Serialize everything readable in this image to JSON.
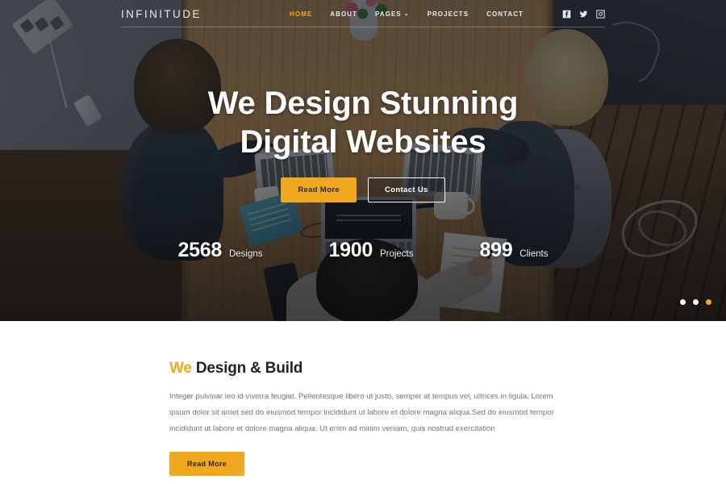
{
  "header": {
    "logo": "INFINITUDE",
    "nav": [
      {
        "label": "HOME",
        "active": true,
        "caret": ""
      },
      {
        "label": "ABOUT",
        "active": false,
        "caret": ""
      },
      {
        "label": "PAGES",
        "active": false,
        "caret": "⌄"
      },
      {
        "label": "PROJECTS",
        "active": false,
        "caret": ""
      },
      {
        "label": "CONTACT",
        "active": false,
        "caret": ""
      }
    ],
    "socials": [
      {
        "name": "facebook-icon"
      },
      {
        "name": "twitter-icon"
      },
      {
        "name": "instagram-icon"
      }
    ]
  },
  "hero": {
    "title_line1": "We Design Stunning",
    "title_line2": "Digital Websites",
    "primary_button": "Read More",
    "secondary_button": "Contact Us",
    "stats": [
      {
        "value": "2568",
        "label": "Designs"
      },
      {
        "value": "1900",
        "label": "Projects"
      },
      {
        "value": "899",
        "label": "Clients"
      }
    ],
    "slider_dots": [
      {
        "active": false
      },
      {
        "active": false
      },
      {
        "active": true
      }
    ]
  },
  "about": {
    "title_highlight": "We",
    "title_rest": "Design & Build",
    "paragraph": "Integer pulvinar leo id viverra feugiat. Pellentesque libero ut justo, semper at tempus vel, ultrices in ligula. Lorem ipsum dolor sit amet sed do eiusmod tempor incididunt ut labore et dolore magna aliqua.Sed do eiusmod tempor incididunt ut labore et dolore magna aliqua. Ut enim ad minim veniam, quis nostrud exercitation",
    "button": "Read More"
  },
  "colors": {
    "accent": "#f0a81e",
    "heading": "#232323",
    "body_text": "#777777",
    "header_text": "#e9ecef"
  }
}
